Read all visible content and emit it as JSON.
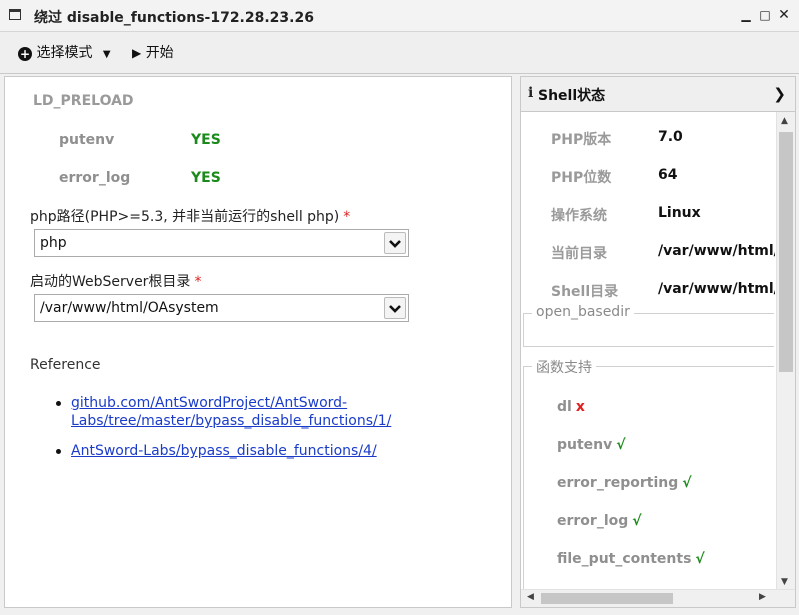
{
  "window": {
    "title": "绕过 disable_functions-172.28.23.26"
  },
  "toolbar": {
    "mode_label": "选择模式",
    "start_label": "开始"
  },
  "left": {
    "section_title": "LD_PRELOAD",
    "checks": [
      {
        "name": "putenv",
        "value": "YES"
      },
      {
        "name": "error_log",
        "value": "YES"
      }
    ],
    "php_path": {
      "label": "php路径(PHP>=5.3, 并非当前运行的shell php)",
      "required": "*",
      "value": "php"
    },
    "web_root": {
      "label": "启动的WebServer根目录",
      "required": "*",
      "value": "/var/www/html/OAsystem"
    },
    "reference_title": "Reference",
    "references": [
      "github.com/AntSwordProject/AntSword-Labs/tree/master/bypass_disable_functions/1/",
      "AntSword-Labs/bypass_disable_functions/4/"
    ]
  },
  "right": {
    "title": "Shell状态",
    "status": [
      {
        "key": "PHP版本",
        "value": "7.0"
      },
      {
        "key": "PHP位数",
        "value": "64"
      },
      {
        "key": "操作系统",
        "value": "Linux"
      },
      {
        "key": "当前目录",
        "value": "/var/www/html/OAsystem"
      },
      {
        "key": "Shell目录",
        "value": "/var/www/html/OAsystem"
      }
    ],
    "open_basedir_label": "open_basedir",
    "functions_label": "函数支持",
    "functions": [
      {
        "name": "dl",
        "mark": "x",
        "ok": false
      },
      {
        "name": "putenv",
        "mark": "√",
        "ok": true
      },
      {
        "name": "error_reporting",
        "mark": "√",
        "ok": true
      },
      {
        "name": "error_log",
        "mark": "√",
        "ok": true
      },
      {
        "name": "file_put_contents",
        "mark": "√",
        "ok": true
      }
    ]
  }
}
